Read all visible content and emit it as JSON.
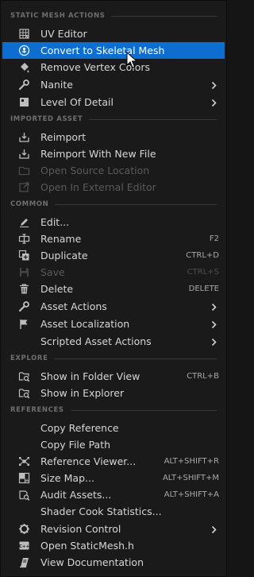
{
  "menu": {
    "sections": [
      {
        "title": "STATIC MESH ACTIONS"
      },
      {
        "title": "IMPORTED ASSET"
      },
      {
        "title": "COMMON"
      },
      {
        "title": "EXPLORE"
      },
      {
        "title": "REFERENCES"
      }
    ],
    "items": [
      {
        "label": "UV Editor",
        "icon": "uv-grid-icon"
      },
      {
        "label": "Convert to Skeletal Mesh",
        "icon": "skeletal-mesh-icon",
        "highlighted": true
      },
      {
        "label": "Remove Vertex Colors",
        "icon": "paint-bucket-icon"
      },
      {
        "label": "Nanite",
        "icon": "wrench-icon",
        "submenu": true
      },
      {
        "label": "Level Of Detail",
        "icon": "lod-icon",
        "submenu": true
      },
      {
        "label": "Reimport",
        "icon": "reimport-icon"
      },
      {
        "label": "Reimport With New File",
        "icon": "reimport-icon"
      },
      {
        "label": "Open Source Location",
        "icon": "folder-icon",
        "disabled": true
      },
      {
        "label": "Open In External Editor",
        "icon": "external-editor-icon",
        "disabled": true
      },
      {
        "label": "Edit...",
        "icon": "pencil-icon"
      },
      {
        "label": "Rename",
        "icon": "rename-icon",
        "shortcut": "F2"
      },
      {
        "label": "Duplicate",
        "icon": "duplicate-icon",
        "shortcut": "CTRL+D"
      },
      {
        "label": "Save",
        "icon": "save-icon",
        "shortcut": "CTRL+S",
        "disabled": true
      },
      {
        "label": "Delete",
        "icon": "trash-icon",
        "shortcut": "DELETE"
      },
      {
        "label": "Asset Actions",
        "icon": "wrench-icon",
        "submenu": true
      },
      {
        "label": "Asset Localization",
        "icon": "flag-icon",
        "submenu": true
      },
      {
        "label": "Scripted Asset Actions",
        "icon": "blank-icon",
        "submenu": true
      },
      {
        "label": "Show in Folder View",
        "icon": "folder-search-icon",
        "shortcut": "CTRL+B"
      },
      {
        "label": "Show in Explorer",
        "icon": "folder-search-icon"
      },
      {
        "label": "Copy Reference",
        "icon": "blank-icon"
      },
      {
        "label": "Copy File Path",
        "icon": "blank-icon"
      },
      {
        "label": "Reference Viewer...",
        "icon": "reference-viewer-icon",
        "shortcut": "ALT+SHIFT+R"
      },
      {
        "label": "Size Map...",
        "icon": "size-map-icon",
        "shortcut": "ALT+SHIFT+M"
      },
      {
        "label": "Audit Assets...",
        "icon": "audit-icon",
        "shortcut": "ALT+SHIFT+A"
      },
      {
        "label": "Shader Cook Statistics...",
        "icon": "blank-icon"
      },
      {
        "label": "Revision Control",
        "icon": "revision-control-icon",
        "submenu": true
      },
      {
        "label": "Open StaticMesh.h",
        "icon": "cpp-file-icon"
      },
      {
        "label": "View Documentation",
        "icon": "book-icon"
      }
    ]
  },
  "colors": {
    "background": "#1a1a1a",
    "highlight": "#0e6ed0",
    "text": "#d6d6d6",
    "disabled_text": "#5a5a5a",
    "section_text": "#6e6e6e"
  }
}
